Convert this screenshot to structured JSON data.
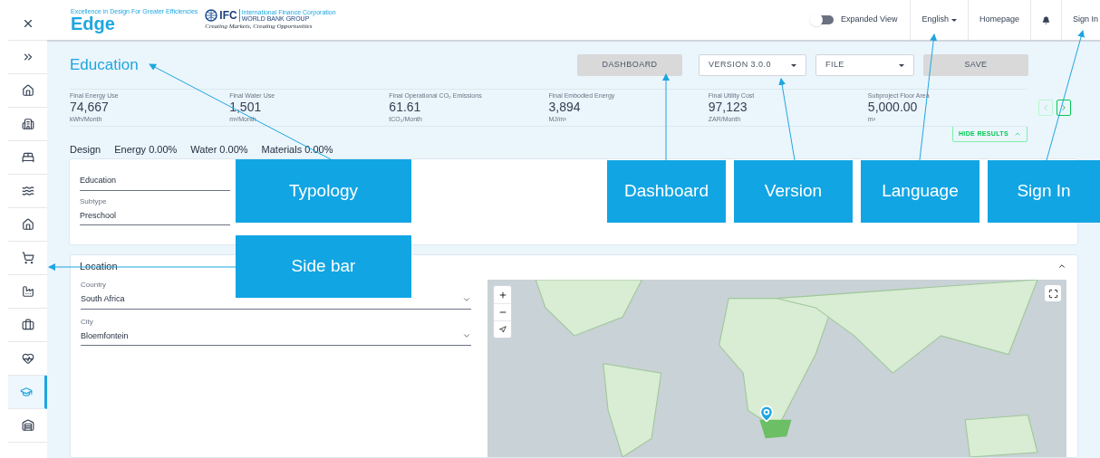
{
  "sidebar": {
    "items": [
      {
        "selected": false
      },
      {
        "selected": false
      },
      {
        "selected": false
      },
      {
        "selected": false
      },
      {
        "selected": false
      },
      {
        "selected": false
      },
      {
        "selected": false
      },
      {
        "selected": false
      },
      {
        "selected": false
      },
      {
        "selected": false
      },
      {
        "selected": false
      },
      {
        "selected": true
      },
      {
        "selected": false
      }
    ]
  },
  "logo": {
    "edge": "Edge",
    "edge_tagline": "Excellence in Design For Greater Efficiencies",
    "ifc": "IFC",
    "ifc_name": "International Finance Corporation",
    "ifc_group": "WORLD BANK GROUP",
    "ifc_slogan": "Creating Markets, Creating Opportunities"
  },
  "header": {
    "toggle": {
      "label": "Expanded View",
      "on": false
    },
    "language": "English",
    "homepage": "Homepage",
    "sign_in": "Sign In"
  },
  "page_title": "Education",
  "toolbar": [
    {
      "kind": "button",
      "label": "DASHBOARD"
    },
    {
      "kind": "dropdown",
      "label": "VERSION 3.0.0"
    },
    {
      "kind": "dropdown",
      "label": "FILE"
    },
    {
      "kind": "button",
      "label": "SAVE"
    }
  ],
  "metrics": [
    {
      "label": "Final Energy Use",
      "value": "74,667",
      "unit": "kWh/Month"
    },
    {
      "label": "Final Water Use",
      "value": "1,501",
      "unit": "m³/Month"
    },
    {
      "label": "Final Operational CO₂ Emissions",
      "value": "61.61",
      "unit": "tCO₂/Month"
    },
    {
      "label": "Final Embodied Energy",
      "value": "3,894",
      "unit": "MJ/m²"
    },
    {
      "label": "Final Utility Cost",
      "value": "97,123",
      "unit": "ZAR/Month"
    },
    {
      "label": "Subproject Floor Area",
      "value": "5,000.00",
      "unit": "m²"
    }
  ],
  "carousel": {
    "prev_disabled": true,
    "next_disabled": false
  },
  "hide_results": "HIDE RESULTS",
  "tabs": [
    {
      "label": "Design",
      "selected": true
    },
    {
      "label": "Energy 0.00%",
      "selected": false
    },
    {
      "label": "Water 0.00%",
      "selected": false
    },
    {
      "label": "Materials 0.00%",
      "selected": false
    }
  ],
  "design_card": {
    "fields": [
      {
        "value": "Education"
      },
      {
        "label": "Subtype",
        "value": "Preschool"
      }
    ]
  },
  "location_card": {
    "title": "Location",
    "expanded": true,
    "fields": [
      {
        "label": "Country",
        "value": "South Africa"
      },
      {
        "label": "City",
        "value": "Bloemfontein"
      }
    ]
  },
  "annotations": [
    {
      "label": "Typology"
    },
    {
      "label": "Side bar"
    },
    {
      "label": "Dashboard"
    },
    {
      "label": "Version"
    },
    {
      "label": "Language"
    },
    {
      "label": "Sign In"
    }
  ]
}
